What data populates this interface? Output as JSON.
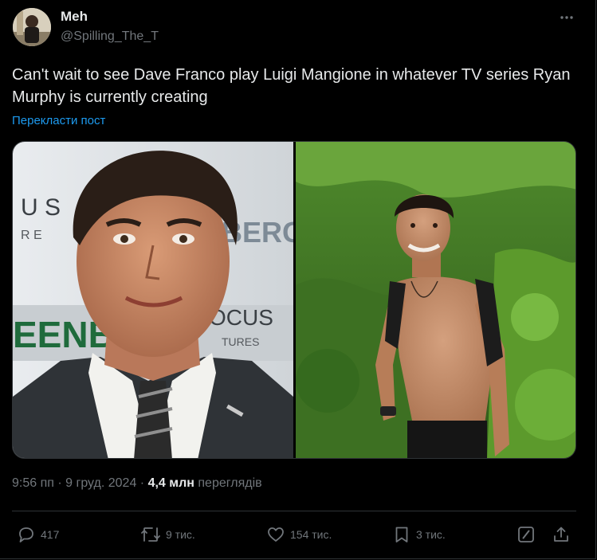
{
  "author": {
    "name": "Meh",
    "handle": "@Spilling_The_T"
  },
  "tweet": {
    "text": "Can't wait to see Dave Franco play Luigi Mangione in whatever TV series Ryan Murphy is currently creating",
    "translate_label": "Перекласти пост"
  },
  "media": {
    "left_image": {
      "backdrop_text_top": "U S",
      "backdrop_text_r": "R E",
      "backdrop_text_berg": "BERG",
      "backdrop_text_een": "EENB",
      "backdrop_text_ocus": "OCUS",
      "backdrop_text_tures": "TURES"
    },
    "right_image": {}
  },
  "meta": {
    "time": "9:56 пп",
    "date": "9 груд. 2024",
    "views_count": "4,4 млн",
    "views_label": "переглядів",
    "sep": "·"
  },
  "actions": {
    "replies": "417",
    "reposts": "9 тис.",
    "likes": "154 тис.",
    "bookmarks": "3 тис."
  },
  "colors": {
    "background": "#000000",
    "text_primary": "#e7e9ea",
    "text_secondary": "#71767b",
    "link": "#1d9bf0",
    "border": "#2f3336"
  },
  "icons": {
    "more": "more-dots-icon",
    "reply": "reply-bubble-icon",
    "repost": "repost-arrows-icon",
    "like": "heart-icon",
    "bookmark": "bookmark-icon",
    "grok": "grok-slash-icon",
    "share": "share-upload-icon"
  }
}
